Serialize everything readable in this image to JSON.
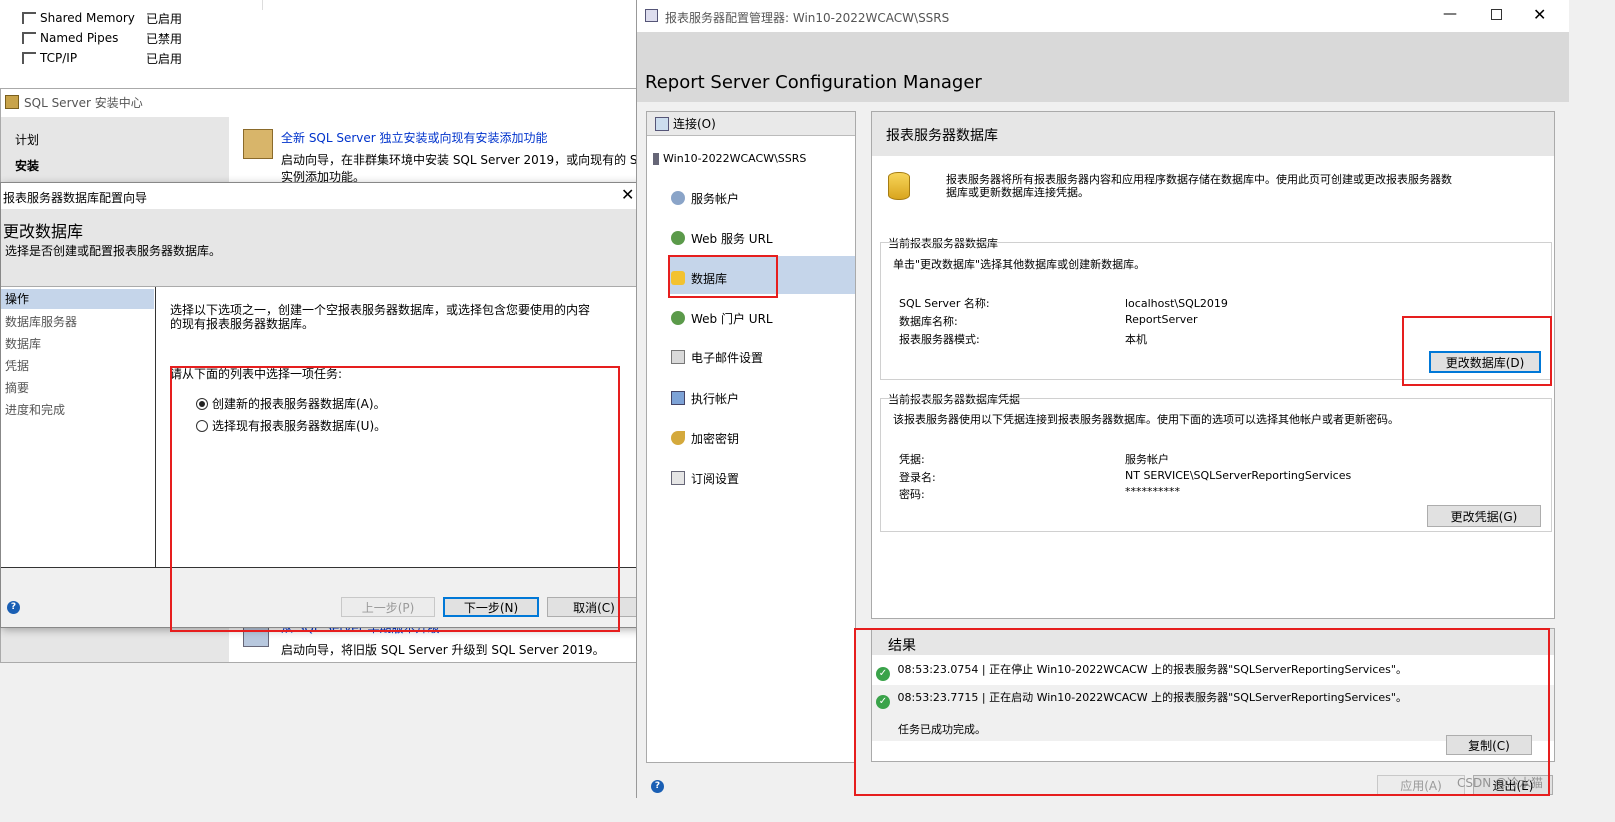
{
  "bg_window": {
    "protocols": [
      {
        "name": "Shared Memory",
        "status": "已启用"
      },
      {
        "name": "Named Pipes",
        "status": "已禁用"
      },
      {
        "name": "TCP/IP",
        "status": "已启用"
      }
    ]
  },
  "install_center": {
    "title": "SQL Server 安装中心",
    "nav": [
      "计划",
      "安装"
    ],
    "items": [
      {
        "link": "全新 SQL Server 独立安装或向现有安装添加功能",
        "desc1": "启动向导，在非群集环境中安装 SQL Server 2019，或向现有的 SQL",
        "desc2": "实例添加功能。"
      },
      {
        "link": "从 SQL Server 早期版本升级",
        "desc1": "启动向导，将旧版 SQL Server 升级到 SQL Server 2019。",
        "desc2": ""
      }
    ]
  },
  "wizard": {
    "title": "报表服务器数据库配置向导",
    "heading": "更改数据库",
    "subheading": "选择是否创建或配置报表服务器数据库。",
    "steps": [
      "操作",
      "数据库服务器",
      "数据库",
      "凭据",
      "摘要",
      "进度和完成"
    ],
    "intro_line1": "选择以下选项之一，创建一个空报表服务器数据库，或选择包含您要使用的内容",
    "intro_line2": "的现有报表服务器数据库。",
    "task_label": "请从下面的列表中选择一项任务:",
    "options": [
      "创建新的报表服务器数据库(A)。",
      "选择现有报表服务器数据库(U)。"
    ],
    "buttons": {
      "prev": "上一步(P)",
      "next": "下一步(N)",
      "cancel": "取消(C)"
    }
  },
  "rscm": {
    "window_title": "报表服务器配置管理器: Win10-2022WCACW\\SSRS",
    "app_title": "Report Server Configuration Manager",
    "connect": "连接(O)",
    "server_node": "Win10-2022WCACW\\SSRS",
    "nav": [
      "服务帐户",
      "Web 服务 URL",
      "数据库",
      "Web 门户 URL",
      "电子邮件设置",
      "执行帐户",
      "加密密钥",
      "订阅设置"
    ],
    "section_title": "报表服务器数据库",
    "desc_line1": "报表服务器将所有报表服务器内容和应用程序数据存储在数据库中。使用此页可创建或更改报表服务器数",
    "desc_line2": "据库或更新数据库连接凭据。",
    "current_db": {
      "group_title": "当前报表服务器数据库",
      "hint": "单击\"更改数据库\"选择其他数据库或创建新数据库。",
      "rows": [
        {
          "label": "SQL Server 名称:",
          "value": "localhost\\SQL2019"
        },
        {
          "label": "数据库名称:",
          "value": "ReportServer"
        },
        {
          "label": "报表服务器模式:",
          "value": "本机"
        }
      ],
      "button": "更改数据库(D)"
    },
    "credentials": {
      "group_title": "当前报表服务器数据库凭据",
      "hint": "该报表服务器使用以下凭据连接到报表服务器数据库。使用下面的选项可以选择其他帐户或者更新密码。",
      "rows": [
        {
          "label": "凭据:",
          "value": "服务帐户"
        },
        {
          "label": "登录名:",
          "value": "NT SERVICE\\SQLServerReportingServices"
        },
        {
          "label": "密码:",
          "value": "**********"
        }
      ],
      "button": "更改凭据(G)"
    },
    "results": {
      "title": "结果",
      "lines": [
        "08:53:23.0754 | 正在停止 Win10-2022WCACW 上的报表服务器\"SQLServerReportingServices\"。",
        "08:53:23.7715 | 正在启动 Win10-2022WCACW 上的报表服务器\"SQLServerReportingServices\"。"
      ],
      "done": "任务已成功完成。",
      "copy": "复制(C)"
    },
    "footer": {
      "apply": "应用(A)",
      "exit": "退出(E)"
    },
    "watermark": "CSDN @冷水猫"
  },
  "colors": {
    "highlight": "#e61e1e",
    "selected": "#c5d5ea",
    "link": "#0033cc",
    "ok": "#3aa34a"
  }
}
